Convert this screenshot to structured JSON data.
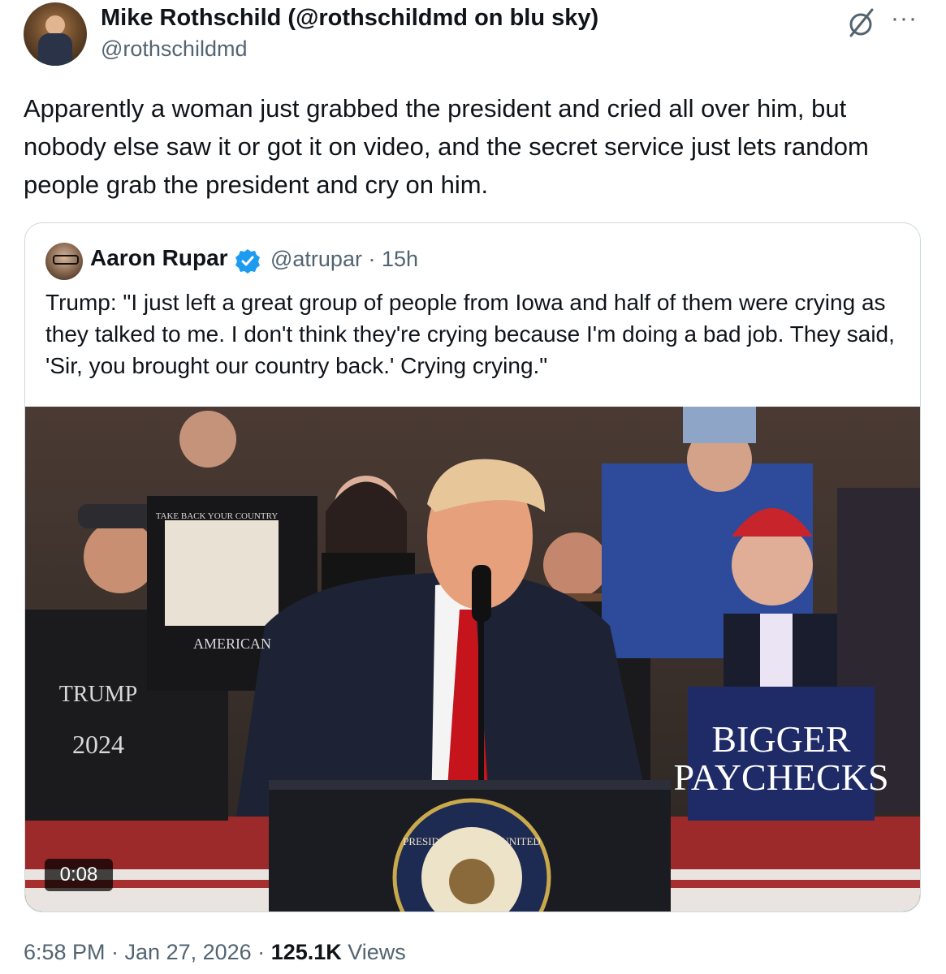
{
  "author": {
    "name": "Mike Rothschild (@rothschildmd on blu sky)",
    "handle": "@rothschildmd"
  },
  "post": {
    "text": "Apparently a woman just grabbed the president and cried all over him, but nobody else saw it or got it on video, and the secret service just lets random people grab the president and cry on him.",
    "timestamp": "6:58 PM · Jan 27, 2026 · ",
    "views_count": "125.1K",
    "views_label": " Views"
  },
  "quoted": {
    "name": "Aaron Rupar",
    "handle": "@atrupar",
    "age": "15h",
    "separator": " · ",
    "text": "Trump: \"I just left a great group of people from Iowa and half of them were crying as they talked to me. I don't think they're crying because I'm doing a bad job. They said, 'Sir, you brought our country back.' Crying crying.\"",
    "video_duration": "0:08",
    "sign_line1": "BIGGER",
    "sign_line2": "PAYCHECKS",
    "shirt_text1": "TRUMP",
    "shirt_text2": "2024",
    "shirt_text3": "TAKE BACK YOUR COUNTRY",
    "shirt_text4": "AMERICAN",
    "podium_text": "PRESIDENT OF THE UNITED"
  },
  "icons": {
    "grok": "grok-icon",
    "more": "more-icon",
    "verified": "verified-badge-icon",
    "verified_color": "#1d9bf0"
  }
}
